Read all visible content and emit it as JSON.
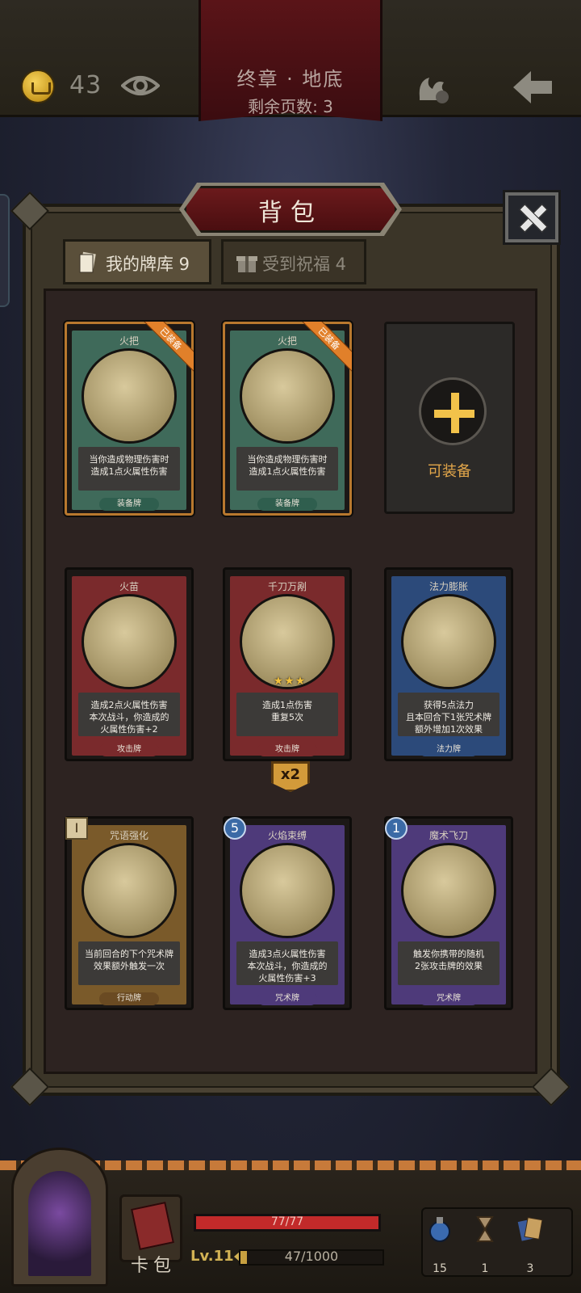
{
  "top_bar": {
    "gold_count": "43",
    "chapter_title": "终章 · 地底",
    "pages_left": "剩余页数: 3"
  },
  "panel": {
    "title": "背包",
    "tabs": [
      {
        "label": "我的牌库 9",
        "active": true
      },
      {
        "label": "受到祝福 4",
        "active": false
      }
    ],
    "empty_slot_label": "可装备",
    "equipped_tag": "已装备",
    "stack_badge": "x2",
    "cards": [
      {
        "name": "火把",
        "desc": "当你造成物理伤害时\n造成1点火属性伤害",
        "type": "装备牌",
        "equipped": true,
        "frame_color": "#3f6a5a",
        "type_color": "#2f5e4e"
      },
      {
        "name": "火把",
        "desc": "当你造成物理伤害时\n造成1点火属性伤害",
        "type": "装备牌",
        "equipped": true,
        "frame_color": "#3f6a5a",
        "type_color": "#2f5e4e"
      },
      {
        "name": "火苗",
        "desc": "造成2点火属性伤害\n本次战斗，你造成的\n火属性伤害+2",
        "type": "攻击牌",
        "frame_color": "#7a2a2c",
        "type_color": "#7a2a2c"
      },
      {
        "name": "千刀万剐",
        "desc": "造成1点伤害\n重复5次",
        "type": "攻击牌",
        "stars": "★★★",
        "frame_color": "#7a2a2c",
        "type_color": "#7a2a2c"
      },
      {
        "name": "法力膨胀",
        "desc": "获得5点法力\n且本回合下1张咒术牌\n额外增加1次效果",
        "type": "法力牌",
        "frame_color": "#2c4a7a",
        "type_color": "#2c4a7a"
      },
      {
        "name": "咒语强化",
        "desc": "当前回合的下个咒术牌\n效果额外触发一次",
        "type": "行动牌",
        "cost": "I",
        "frame_color": "#7a5a2a",
        "type_color": "#6a4a22"
      },
      {
        "name": "火焰束缚",
        "desc": "造成3点火属性伤害\n本次战斗，你造成的\n火属性伤害+3",
        "type": "咒术牌",
        "cost": "5",
        "frame_color": "#4e3a7a",
        "type_color": "#4e3a7a"
      },
      {
        "name": "魔术飞刀",
        "desc": "触发你携带的随机\n2张攻击牌的效果",
        "type": "咒术牌",
        "cost": "1",
        "frame_color": "#4e3a7a",
        "type_color": "#4e3a7a"
      }
    ]
  },
  "hud": {
    "deck_label": "卡包",
    "hp_text": "77/77",
    "hp_fraction": 1.0,
    "level": "Lv.11",
    "xp_text": "47/1000",
    "xp_fraction": 0.047,
    "resources": [
      {
        "icon": "potion-icon",
        "value": "15"
      },
      {
        "icon": "hourglass-icon",
        "value": "1"
      },
      {
        "icon": "cards-icon",
        "value": "3"
      }
    ]
  },
  "colors": {
    "panel_bg": "#2d2321",
    "accent_gold": "#f2c24a",
    "hp_red": "#c22a2a"
  }
}
